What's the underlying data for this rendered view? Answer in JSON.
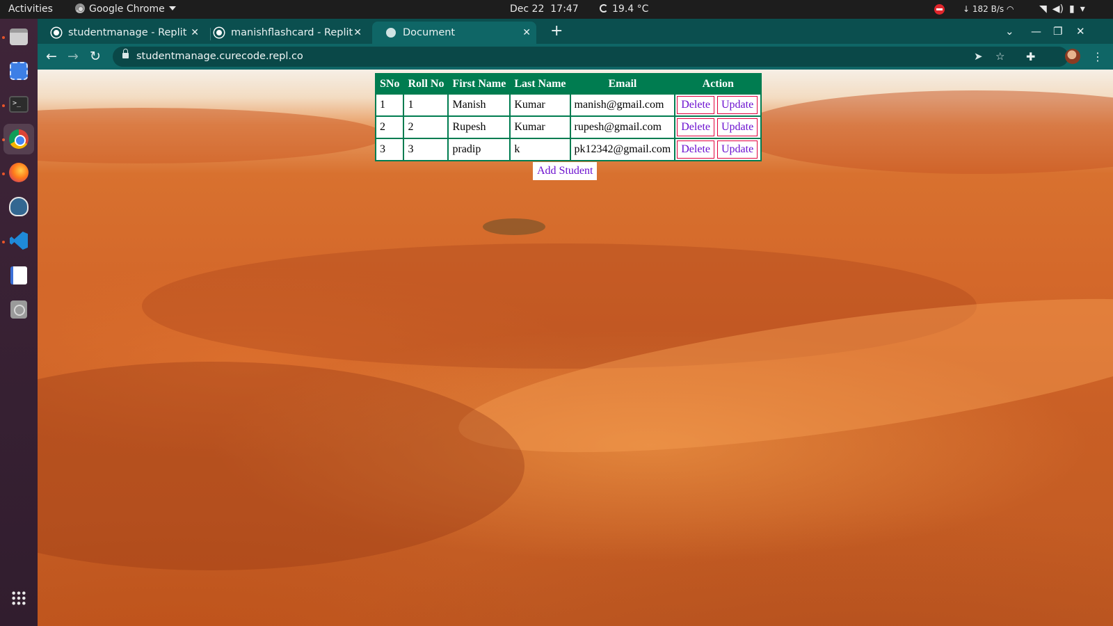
{
  "topbar": {
    "activities": "Activities",
    "app_name": "Google Chrome",
    "date": "Dec 22",
    "time": "17:47",
    "temperature": "19.4 °C",
    "net_speed": "↓ 182 B/s"
  },
  "dock": {
    "items": [
      "files",
      "screenshot",
      "terminal",
      "chrome",
      "firefox",
      "pgadmin",
      "vscode",
      "text-editor",
      "disc",
      "show-apps"
    ]
  },
  "browser": {
    "tabs": [
      {
        "title": "studentmanage - Replit",
        "active": false
      },
      {
        "title": "manishflashcard - Replit",
        "active": false
      },
      {
        "title": "Document",
        "active": true
      }
    ],
    "url": "studentmanage.curecode.repl.co"
  },
  "page": {
    "table": {
      "headers": [
        "SNo",
        "Roll No",
        "First Name",
        "Last Name",
        "Email",
        "Action"
      ],
      "rows": [
        {
          "sno": "1",
          "roll": "1",
          "first": "Manish",
          "last": "Kumar",
          "email": "manish@gmail.com"
        },
        {
          "sno": "2",
          "roll": "2",
          "first": "Rupesh",
          "last": "Kumar",
          "email": "rupesh@gmail.com"
        },
        {
          "sno": "3",
          "roll": "3",
          "first": "pradip",
          "last": "k",
          "email": "pk12342@gmail.com"
        }
      ],
      "delete_label": "Delete",
      "update_label": "Update"
    },
    "add_button": "Add Student"
  },
  "colors": {
    "chrome_frame": "#0b4f4f",
    "chrome_toolbar": "#0f6666",
    "table_header": "#007c50",
    "button_text": "#6b0fcf",
    "button_border": "#e0003c"
  }
}
